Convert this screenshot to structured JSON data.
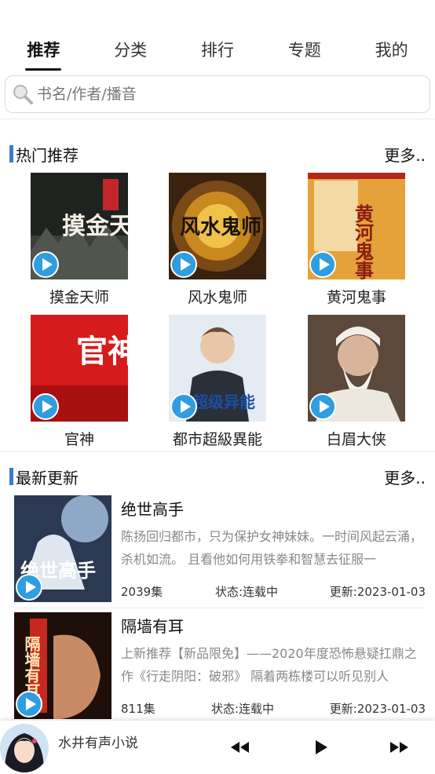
{
  "tabs": [
    {
      "label": "推荐",
      "active": true
    },
    {
      "label": "分类",
      "active": false
    },
    {
      "label": "排行",
      "active": false
    },
    {
      "label": "专题",
      "active": false
    },
    {
      "label": "我的",
      "active": false
    }
  ],
  "search": {
    "placeholder": "书名/作者/播音",
    "value": ""
  },
  "hot": {
    "title": "热门推荐",
    "more": "更多..",
    "items": [
      {
        "title": "摸金天师",
        "cover_text": "摸金天师"
      },
      {
        "title": "风水鬼师",
        "cover_text": "风水鬼师"
      },
      {
        "title": "黄河鬼事",
        "cover_text": "黄河鬼事"
      },
      {
        "title": "官神",
        "cover_text": "官神"
      },
      {
        "title": "都市超級異能",
        "cover_text": "超级异能"
      },
      {
        "title": "白眉大侠",
        "cover_text": ""
      }
    ]
  },
  "latest": {
    "title": "最新更新",
    "more": "更多..",
    "items": [
      {
        "title": "绝世高手",
        "cover_text": "绝世高手",
        "desc": "陈扬回归都市，只为保护女神妹妹。一时间风起云涌，杀机如流。 且看他如何用铁拳和智慧去征服一",
        "episodes": "2039集",
        "status": "状态:连载中",
        "updated": "更新:2023-01-03"
      },
      {
        "title": "隔墙有耳",
        "cover_text": "隔墙有耳",
        "desc": "上新推荐【新品限免】——2020年度恐怖悬疑扛鼎之作《行走阴阳：破邪》 隔着两栋楼可以听见别人",
        "episodes": "811集",
        "status": "状态:连载中",
        "updated": "更新:2023-01-03"
      }
    ]
  },
  "player": {
    "title": "水井有声小说"
  },
  "colors": {
    "accent": "#3a7bd5",
    "play": "#2f9de0",
    "muted": "#888888"
  }
}
